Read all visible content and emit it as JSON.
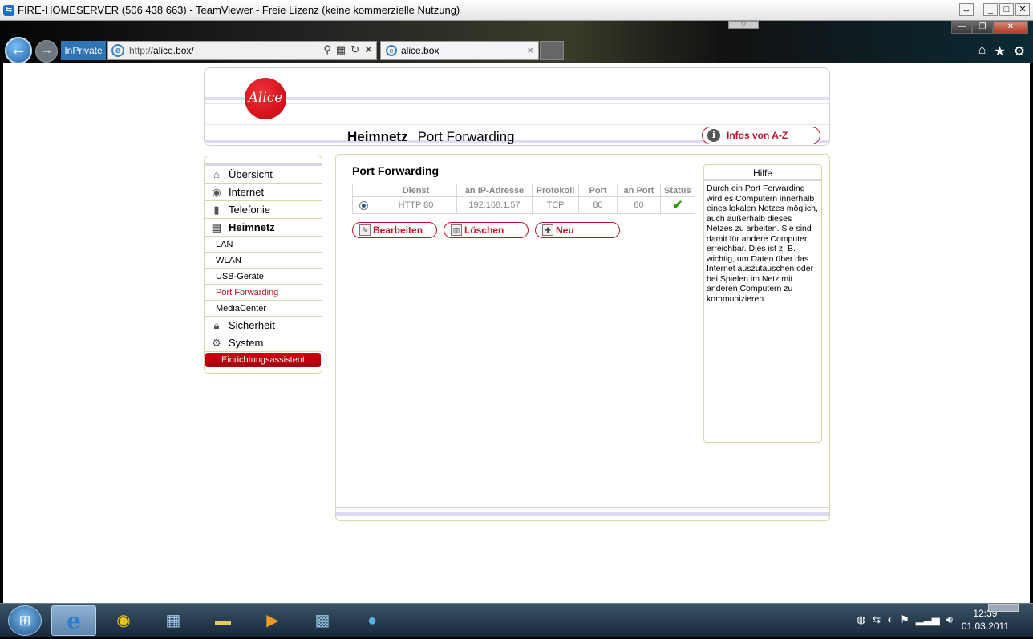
{
  "teamviewer": {
    "title": "FIRE-HOMESERVER (506 438 663) - TeamViewer - Freie Lizenz (keine kommerzielle Nutzung)"
  },
  "browser": {
    "inprivate_label": "InPrivate",
    "url_prefix": "http://",
    "url_host": "alice.box/",
    "tab_title": "alice.box"
  },
  "header": {
    "logo_text": "Alice",
    "section": "Heimnetz",
    "page": "Port Forwarding",
    "infos_button": "Infos von A-Z"
  },
  "sidebar": {
    "items": [
      {
        "label": "Übersicht",
        "icon": "house-icon"
      },
      {
        "label": "Internet",
        "icon": "globe-icon"
      },
      {
        "label": "Telefonie",
        "icon": "phone-icon"
      },
      {
        "label": "Heimnetz",
        "icon": "network-icon"
      }
    ],
    "sub_items": [
      "LAN",
      "WLAN",
      "USB-Geräte",
      "Port Forwarding",
      "MediaCenter"
    ],
    "items_after": [
      {
        "label": "Sicherheit",
        "icon": "lock-icon"
      },
      {
        "label": "System",
        "icon": "gear-icon"
      }
    ],
    "wizard": "Einrichtungsassistent"
  },
  "main": {
    "title": "Port Forwarding",
    "columns": [
      "",
      "Dienst",
      "an IP-Adresse",
      "Protokoll",
      "Port",
      "an Port",
      "Status"
    ],
    "rows": [
      {
        "dienst": "HTTP 80",
        "ip": "192.168.1.57",
        "protokoll": "TCP",
        "port": "80",
        "an_port": "80",
        "status": "active"
      }
    ],
    "buttons": {
      "edit": "Bearbeiten",
      "delete": "Löschen",
      "new": "Neu"
    }
  },
  "help": {
    "title": "Hilfe",
    "text": "Durch ein Port Forwarding wird es Computern innerhalb eines lokalen Netzes möglich, auch außerhalb dieses Netzes zu arbeiten. Sie sind damit für andere Computer erreichbar. Dies ist z. B. wichtig, um Daten über das Internet auszutauschen oder bei Spielen im Netz mit anderen Computern zu kommunizieren."
  },
  "taskbar": {
    "time": "12:39",
    "date": "01.03.2011"
  },
  "colors": {
    "accent_red": "#c0142a",
    "brand_red": "#d00010",
    "stripe_lavender": "#dedcf4"
  }
}
